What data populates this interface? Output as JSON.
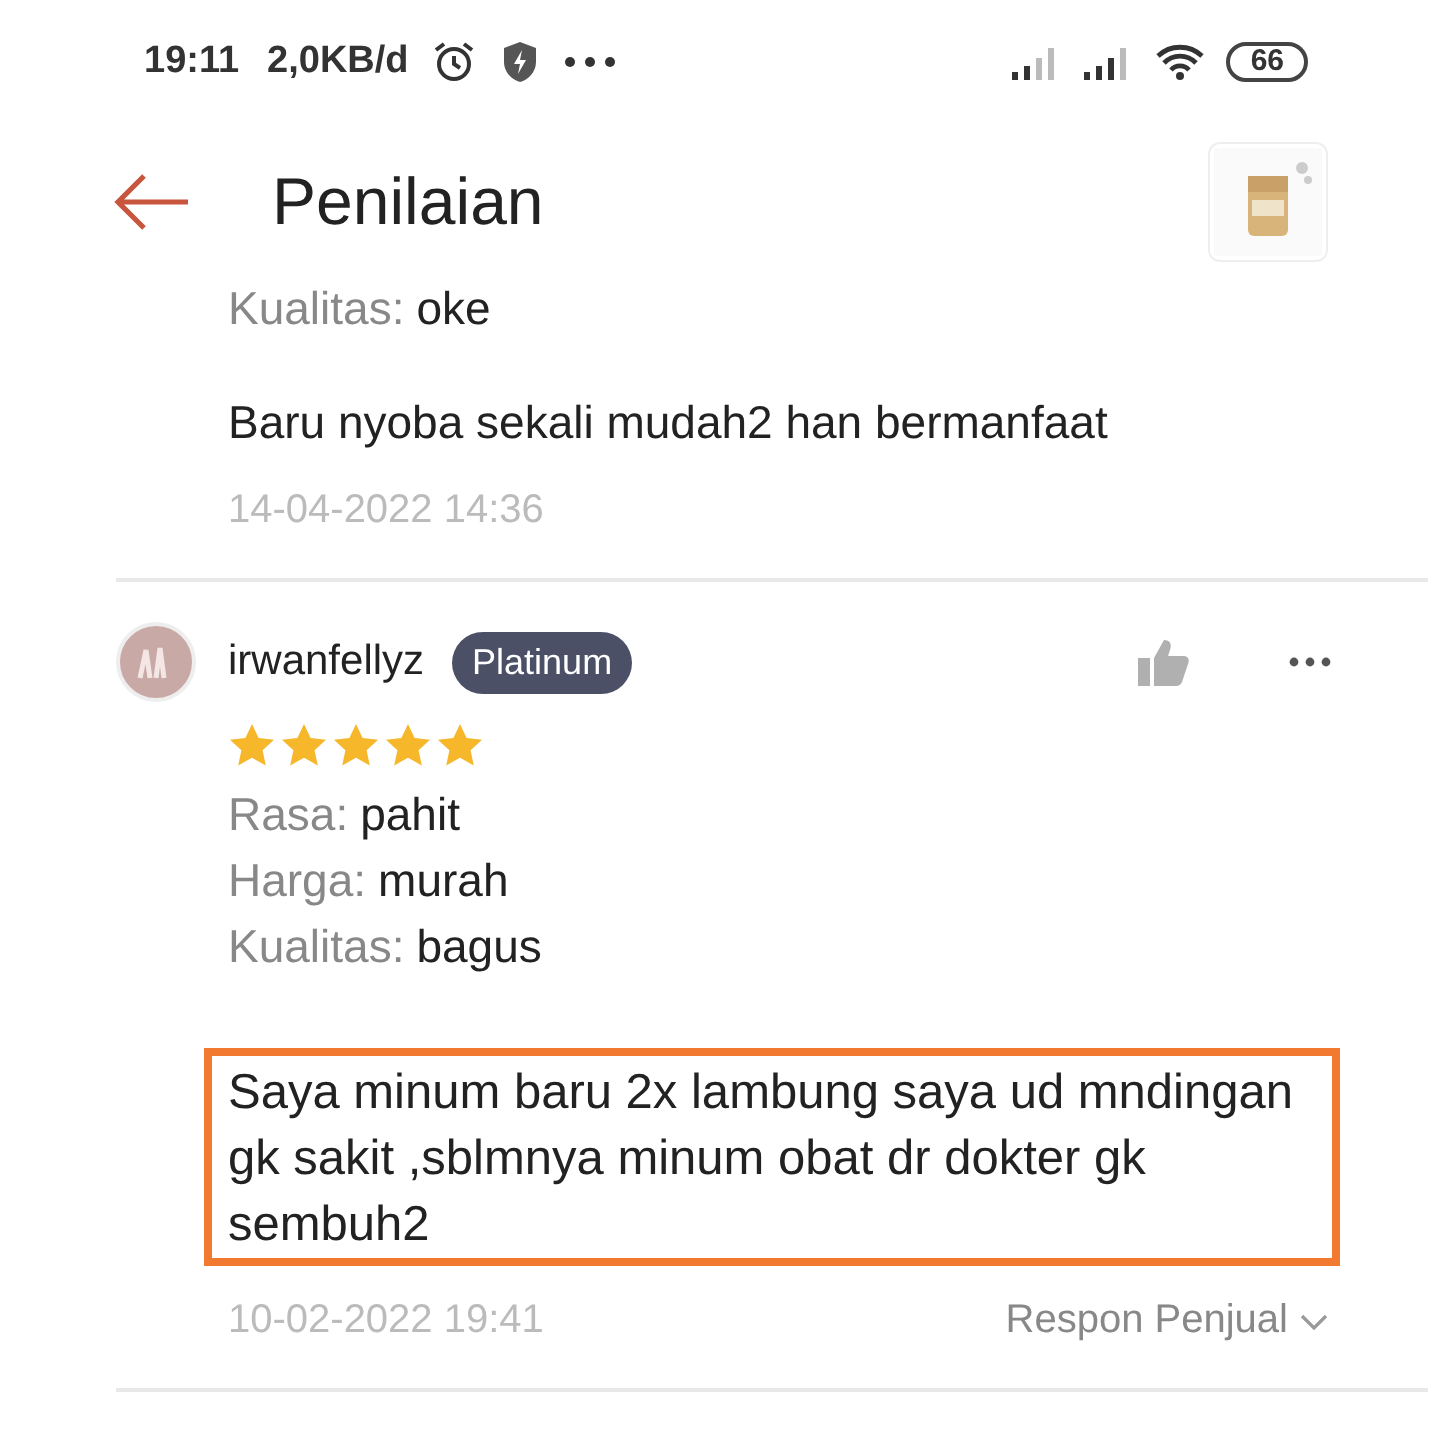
{
  "status_bar": {
    "time": "19:11",
    "speed": "2,0KB/d",
    "battery": "66"
  },
  "header": {
    "title": "Penilaian"
  },
  "reviews": [
    {
      "attributes": [
        {
          "label": "Kualitas:",
          "value": "oke"
        }
      ],
      "text": "Baru nyoba sekali mudah2 han bermanfaat",
      "highlighted": false,
      "date": "14-04-2022 14:36"
    },
    {
      "user": "irwanfellyz",
      "badge": "Platinum",
      "stars": 5,
      "attributes": [
        {
          "label": "Rasa:",
          "value": "pahit"
        },
        {
          "label": "Harga:",
          "value": "murah"
        },
        {
          "label": "Kualitas:",
          "value": "bagus"
        }
      ],
      "text": "Saya minum baru 2x lambung saya ud mndingan gk sakit ,sblmnya minum obat dr dokter gk sembuh2",
      "highlighted": true,
      "date": "10-02-2022 19:41",
      "seller_response": "Respon Penjual"
    }
  ]
}
